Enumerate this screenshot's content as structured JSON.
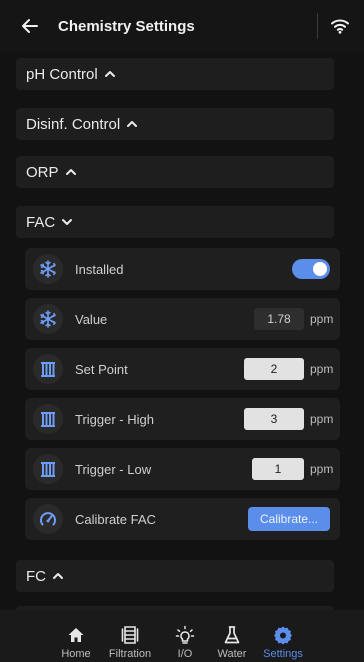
{
  "header": {
    "title": "Chemistry Settings"
  },
  "sections": [
    {
      "label": "pH Control",
      "state": "collapsed"
    },
    {
      "label": "Disinf. Control",
      "state": "collapsed"
    },
    {
      "label": "ORP",
      "state": "collapsed"
    },
    {
      "label": "FAC",
      "state": "expanded"
    },
    {
      "label": "FC",
      "state": "collapsed"
    }
  ],
  "fac": {
    "installed": {
      "label": "Installed",
      "on": true
    },
    "value": {
      "label": "Value",
      "value": "1.78",
      "unit": "ppm"
    },
    "set_point": {
      "label": "Set Point",
      "value": "2",
      "unit": "ppm"
    },
    "trigger_high": {
      "label": "Trigger - High",
      "value": "3",
      "unit": "ppm"
    },
    "trigger_low": {
      "label": "Trigger - Low",
      "value": "1",
      "unit": "ppm"
    },
    "calibrate": {
      "label": "Calibrate FAC",
      "button": "Calibrate..."
    }
  },
  "nav": [
    {
      "label": "Home",
      "icon": "home-icon",
      "active": false
    },
    {
      "label": "Filtration",
      "icon": "filtration-icon",
      "active": false
    },
    {
      "label": "I/O",
      "icon": "lightbulb-icon",
      "active": false
    },
    {
      "label": "Water",
      "icon": "flask-icon",
      "active": false
    },
    {
      "label": "Settings",
      "icon": "gear-icon",
      "active": true
    }
  ],
  "colors": {
    "accent": "#5b8dea",
    "icon_blue": "#6f9cf5",
    "background": "#121212",
    "card": "#1f1f1f"
  }
}
